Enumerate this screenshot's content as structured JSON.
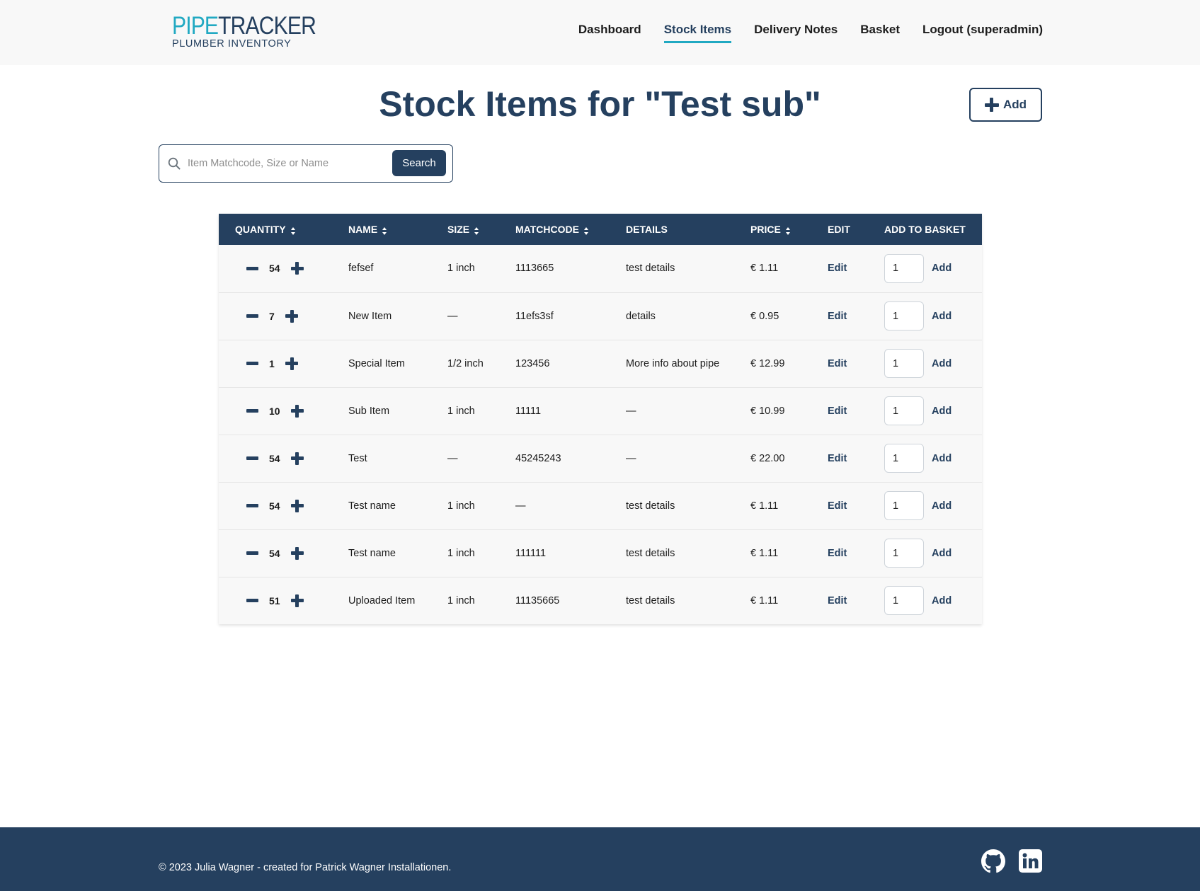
{
  "brand": {
    "logo_word_1": "PIPE",
    "logo_word_2": "TRACKER",
    "logo_subtitle": "PLUMBER INVENTORY",
    "primary_color": "#25405f",
    "accent_color": "#21a9c2"
  },
  "nav": {
    "items": [
      {
        "label": "Dashboard",
        "active": false
      },
      {
        "label": "Stock Items",
        "active": true
      },
      {
        "label": "Delivery Notes",
        "active": false
      },
      {
        "label": "Basket",
        "active": false
      },
      {
        "label": "Logout (superadmin)",
        "active": false
      }
    ]
  },
  "page": {
    "title": "Stock Items for \"Test sub\"",
    "add_label": "Add"
  },
  "search": {
    "placeholder": "Item Matchcode, Size or Name",
    "value": "",
    "button_label": "Search"
  },
  "table": {
    "columns": [
      {
        "label": "QUANTITY",
        "sortable": true
      },
      {
        "label": "NAME",
        "sortable": true
      },
      {
        "label": "SIZE",
        "sortable": true
      },
      {
        "label": "MATCHCODE",
        "sortable": true
      },
      {
        "label": "DETAILS",
        "sortable": false
      },
      {
        "label": "PRICE",
        "sortable": true
      },
      {
        "label": "EDIT",
        "sortable": false
      },
      {
        "label": "ADD TO BASKET",
        "sortable": false
      }
    ],
    "edit_label": "Edit",
    "add_label": "Add",
    "rows": [
      {
        "quantity": "54",
        "name": "fefsef",
        "size": "1 inch",
        "matchcode": "1113665",
        "details": "test details",
        "price": "€ 1.11",
        "basket_qty": "1"
      },
      {
        "quantity": "7",
        "name": "New Item",
        "size": "—",
        "matchcode": "11efs3sf",
        "details": "details",
        "price": "€ 0.95",
        "basket_qty": "1"
      },
      {
        "quantity": "1",
        "name": "Special Item",
        "size": "1/2 inch",
        "matchcode": "123456",
        "details": "More info about pipe",
        "price": "€ 12.99",
        "basket_qty": "1"
      },
      {
        "quantity": "10",
        "name": "Sub Item",
        "size": "1 inch",
        "matchcode": "11111",
        "details": "—",
        "price": "€ 10.99",
        "basket_qty": "1"
      },
      {
        "quantity": "54",
        "name": "Test",
        "size": "—",
        "matchcode": "45245243",
        "details": "—",
        "price": "€ 22.00",
        "basket_qty": "1"
      },
      {
        "quantity": "54",
        "name": "Test name",
        "size": "1 inch",
        "matchcode": "—",
        "details": "test details",
        "price": "€ 1.11",
        "basket_qty": "1"
      },
      {
        "quantity": "54",
        "name": "Test name",
        "size": "1 inch",
        "matchcode": "111111",
        "details": "test details",
        "price": "€ 1.11",
        "basket_qty": "1"
      },
      {
        "quantity": "51",
        "name": "Uploaded Item",
        "size": "1 inch",
        "matchcode": "11135665",
        "details": "test details",
        "price": "€ 1.11",
        "basket_qty": "1"
      }
    ]
  },
  "footer": {
    "copyright": "© 2023 Julia Wagner - created for Patrick Wagner Installationen.",
    "icons": [
      "github-icon",
      "linkedin-icon"
    ]
  }
}
